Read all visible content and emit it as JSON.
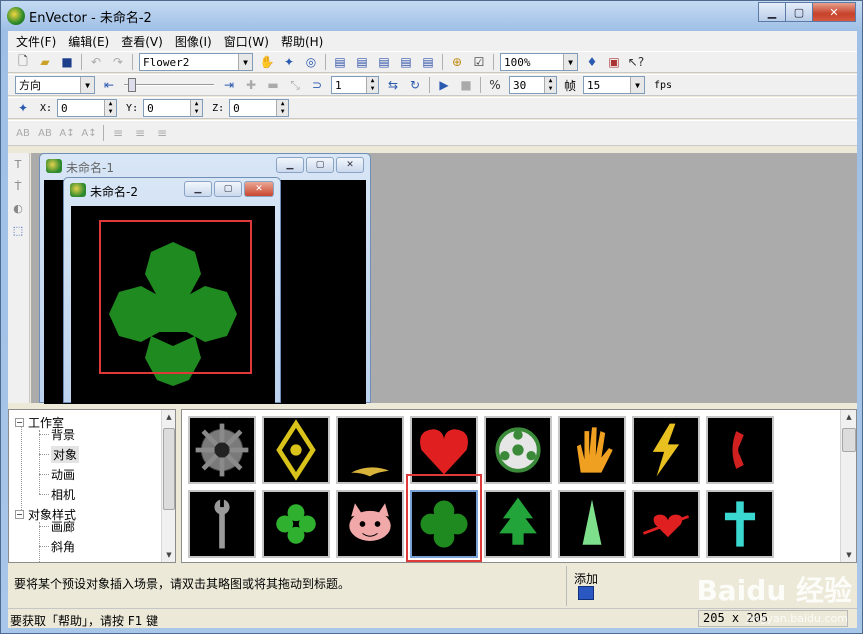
{
  "window": {
    "title": "EnVector - 未命名-2",
    "minimize": "▁",
    "maximize": "▢",
    "close": "✕"
  },
  "menu": [
    "文件(F)",
    "编辑(E)",
    "查看(V)",
    "图像(I)",
    "窗口(W)",
    "帮助(H)"
  ],
  "toolbar1": {
    "object_combo": "Flower2",
    "zoom_combo": "100%"
  },
  "toolbar2": {
    "direction_combo": "方向",
    "frame_spin": "1",
    "percent_spin": "30",
    "frame_label": "帧",
    "fps_combo": "15",
    "fps_label": "fps"
  },
  "toolbar3": {
    "x_label": "X:",
    "x_value": "0",
    "y_label": "Y:",
    "y_value": "0",
    "z_label": "Z:",
    "z_value": "0"
  },
  "toolbar4": {
    "btns": [
      "AB",
      "AB",
      "A↕",
      "A↕",
      "≡",
      "≡",
      "≡"
    ]
  },
  "documents": [
    {
      "title": "未命名-1"
    },
    {
      "title": "未命名-2"
    }
  ],
  "tree": {
    "root1": "工作室",
    "children1": [
      "背景",
      "对象",
      "动画",
      "相机"
    ],
    "root2": "对象样式",
    "children2": [
      "画廊",
      "斜角"
    ]
  },
  "gallery": {
    "items": [
      "gear",
      "diamond-hand",
      "bird",
      "heart",
      "film-reel",
      "hand",
      "lightning",
      "phone",
      "wrench",
      "clover-small",
      "cat-face",
      "clover",
      "tree",
      "sail",
      "heart-arrow",
      "cross"
    ],
    "selected_index": 11
  },
  "info": {
    "text": "要将某个预设对象插入场景，请双击其略图或将其拖动到标题。",
    "add_label": "添加"
  },
  "status": {
    "text": "要获取「帮助」，请按 F1 键",
    "size": "205 x 205"
  },
  "watermark": {
    "text": "Baidu 经验",
    "sub": "jingyan.baidu.com"
  },
  "colors": {
    "clover_green": "#1f8a1f",
    "highlight_red": "#e0393a"
  }
}
